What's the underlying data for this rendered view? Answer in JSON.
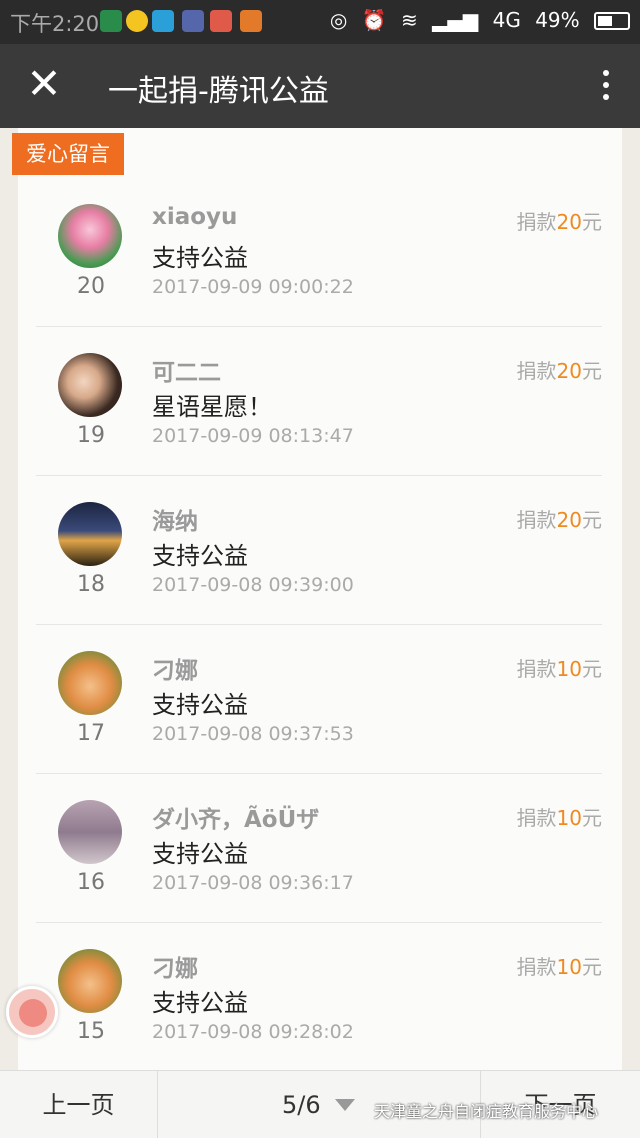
{
  "status_bar": {
    "time": "下午2:20",
    "network": "4G",
    "battery": "49%"
  },
  "header": {
    "title": "一起捐-腾讯公益"
  },
  "section_tag": "爱心留言",
  "donations": [
    {
      "name": "xiaoyu",
      "message": "支持公益",
      "time": "2017-09-09 09:00:22",
      "rank": "20",
      "amount_prefix": "捐款",
      "amount_value": "20",
      "amount_unit": "元"
    },
    {
      "name": "可二二",
      "message": "星语星愿！",
      "time": "2017-09-09 08:13:47",
      "rank": "19",
      "amount_prefix": "捐款",
      "amount_value": "20",
      "amount_unit": "元"
    },
    {
      "name": "海纳",
      "message": "支持公益",
      "time": "2017-09-08 09:39:00",
      "rank": "18",
      "amount_prefix": "捐款",
      "amount_value": "20",
      "amount_unit": "元"
    },
    {
      "name": "刁娜",
      "message": "支持公益",
      "time": "2017-09-08 09:37:53",
      "rank": "17",
      "amount_prefix": "捐款",
      "amount_value": "10",
      "amount_unit": "元"
    },
    {
      "name": "ダ小齐，ÃöÜザ",
      "message": "支持公益",
      "time": "2017-09-08 09:36:17",
      "rank": "16",
      "amount_prefix": "捐款",
      "amount_value": "10",
      "amount_unit": "元"
    },
    {
      "name": "刁娜",
      "message": "支持公益",
      "time": "2017-09-08 09:28:02",
      "rank": "15",
      "amount_prefix": "捐款",
      "amount_value": "10",
      "amount_unit": "元"
    }
  ],
  "pagination": {
    "prev": "上一页",
    "current": "5/6",
    "next": "下一页"
  },
  "watermark": "天津童之舟自闭症教育服务中心",
  "colors": {
    "accent": "#ee6d20",
    "amount": "#ee8a20"
  }
}
